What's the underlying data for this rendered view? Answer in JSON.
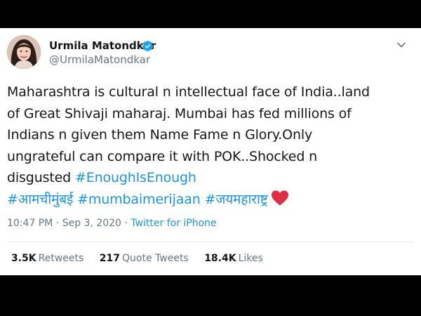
{
  "tweet": {
    "author_name": "Urmila Matondkar",
    "handle": "@UrmilaMatondkar",
    "body_lines": [
      "Maharashtra is cultural n intellectual face of India..land",
      "of Great Shivaji maharaj. Mumbai has fed millions of",
      "Indians n given them Name Fame n Glory.Only",
      "ungrateful can compare it with POK..Shocked n"
    ],
    "line5_text": "disgusted ",
    "hashtag_enough": "#EnoughIsEnough",
    "hashtag_aamchi": "#आमचीमुंबई",
    "hashtag_mumbai": "#mumbaimerijaan",
    "hashtag_jay": "#जयमहाराष्ट्र",
    "time": "10:47 PM",
    "separator": " · ",
    "date": "Sep 3, 2020",
    "source": "Twitter for iPhone",
    "stats": {
      "retweets_count": "3.5K",
      "retweets_label": "Retweets",
      "quotes_count": "217",
      "quotes_label": "Quote Tweets",
      "likes_count": "18.4K",
      "likes_label": "Likes"
    }
  },
  "icons": {
    "verified": "verified-badge-icon",
    "menu": "chevron-down-icon",
    "heart": "red-heart-emoji"
  },
  "colors": {
    "link": "#1b95e0",
    "text": "#14171a",
    "muted": "#657786",
    "heart": "#e0245e",
    "background": "#000000"
  }
}
